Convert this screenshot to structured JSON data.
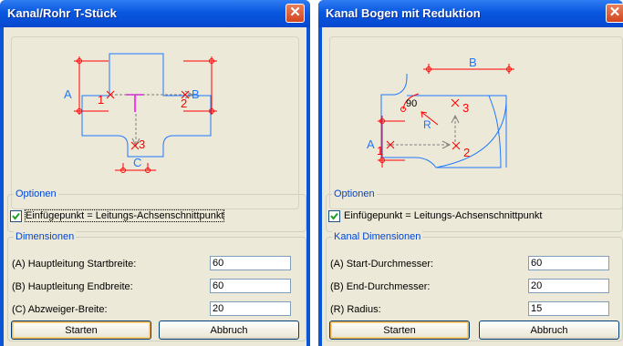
{
  "dialog1": {
    "title": "Kanal/Rohr T-Stück",
    "close_glyph": "✕",
    "drawing": {
      "A": "A",
      "B": "B",
      "C": "C",
      "p1": "1",
      "p2": "2",
      "p3": "3"
    },
    "options_title": "Optionen",
    "checkbox_checked": true,
    "checkbox_label": "Einfügepunkt = Leitungs-Achsenschnittpunkt",
    "dimensions_title": "Dimensionen",
    "fields": [
      {
        "label": "(A) Hauptleitung Startbreite:",
        "value": "60"
      },
      {
        "label": "(B) Hauptleitung Endbreite:",
        "value": "60"
      },
      {
        "label": "(C) Abzweiger-Breite:",
        "value": "20"
      }
    ],
    "start_label": "Starten",
    "cancel_label": "Abbruch"
  },
  "dialog2": {
    "title": "Kanal Bogen mit Reduktion",
    "close_glyph": "✕",
    "drawing": {
      "A": "A",
      "B": "B",
      "R": "R",
      "angle": "90",
      "p1": "1",
      "p2": "2",
      "p3": "3"
    },
    "options_title": "Optionen",
    "checkbox_checked": true,
    "checkbox_label": "Einfügepunkt = Leitungs-Achsenschnittpunkt",
    "dimensions_title": "Kanal Dimensionen",
    "fields": [
      {
        "label": "(A) Start-Durchmesser:",
        "value": "60"
      },
      {
        "label": "(B) End-Durchmesser:",
        "value": "20"
      },
      {
        "label": "(R) Radius:",
        "value": "15"
      }
    ],
    "start_label": "Starten",
    "cancel_label": "Abbruch"
  },
  "colors": {
    "title_bar": "#0a56d6",
    "dialog_bg": "#ece9d8",
    "group_title": "#0046d5",
    "drawing_red": "#ff0000",
    "drawing_blue": "#1e78ff",
    "drawing_magenta": "#ff00ff"
  }
}
